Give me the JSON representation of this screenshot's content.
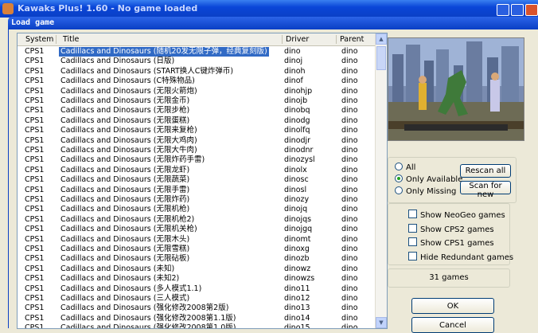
{
  "window": {
    "title": "Kawaks Plus! 1.60 - No game loaded"
  },
  "dialog": {
    "title": "Load game"
  },
  "list": {
    "headers": {
      "system": "System",
      "title": "Title",
      "driver": "Driver",
      "parent": "Parent"
    },
    "rows": [
      {
        "system": "CPS1",
        "title": "Cadillacs and Dinosaurs (随机20发无限子弹，经典复刻版)",
        "driver": "dino",
        "parent": "dino"
      },
      {
        "system": "CPS1",
        "title": "Cadillacs and Dinosaurs (日版)",
        "driver": "dinoj",
        "parent": "dino"
      },
      {
        "system": "CPS1",
        "title": "Cadillacs and Dinosaurs (START换人C键炸弹币)",
        "driver": "dinoh",
        "parent": "dino"
      },
      {
        "system": "CPS1",
        "title": "Cadillacs and Dinosaurs (C特殊物品)",
        "driver": "dinof",
        "parent": "dino"
      },
      {
        "system": "CPS1",
        "title": "Cadillacs and Dinosaurs (无限火箭炮)",
        "driver": "dinohjp",
        "parent": "dino"
      },
      {
        "system": "CPS1",
        "title": "Cadillacs and Dinosaurs (无限金币)",
        "driver": "dinojb",
        "parent": "dino"
      },
      {
        "system": "CPS1",
        "title": "Cadillacs and Dinosaurs (无限步枪)",
        "driver": "dinobq",
        "parent": "dino"
      },
      {
        "system": "CPS1",
        "title": "Cadillacs and Dinosaurs (无限蛋糕)",
        "driver": "dinodg",
        "parent": "dino"
      },
      {
        "system": "CPS1",
        "title": "Cadillacs and Dinosaurs (无限来复枪)",
        "driver": "dinolfq",
        "parent": "dino"
      },
      {
        "system": "CPS1",
        "title": "Cadillacs and Dinosaurs (无限大鸡肉)",
        "driver": "dinodjr",
        "parent": "dino"
      },
      {
        "system": "CPS1",
        "title": "Cadillacs and Dinosaurs (无限大牛肉)",
        "driver": "dinodnr",
        "parent": "dino"
      },
      {
        "system": "CPS1",
        "title": "Cadillacs and Dinosaurs (无限炸药手雷)",
        "driver": "dinozysl",
        "parent": "dino"
      },
      {
        "system": "CPS1",
        "title": "Cadillacs and Dinosaurs (无限龙虾)",
        "driver": "dinolx",
        "parent": "dino"
      },
      {
        "system": "CPS1",
        "title": "Cadillacs and Dinosaurs (无限蔬菜)",
        "driver": "dinosc",
        "parent": "dino"
      },
      {
        "system": "CPS1",
        "title": "Cadillacs and Dinosaurs (无限手雷)",
        "driver": "dinosl",
        "parent": "dino"
      },
      {
        "system": "CPS1",
        "title": "Cadillacs and Dinosaurs (无限炸药)",
        "driver": "dinozy",
        "parent": "dino"
      },
      {
        "system": "CPS1",
        "title": "Cadillacs and Dinosaurs (无限机枪)",
        "driver": "dinojq",
        "parent": "dino"
      },
      {
        "system": "CPS1",
        "title": "Cadillacs and Dinosaurs (无限机枪2)",
        "driver": "dinojqs",
        "parent": "dino"
      },
      {
        "system": "CPS1",
        "title": "Cadillacs and Dinosaurs (无限机关枪)",
        "driver": "dinojgq",
        "parent": "dino"
      },
      {
        "system": "CPS1",
        "title": "Cadillacs and Dinosaurs (无限木头)",
        "driver": "dinomt",
        "parent": "dino"
      },
      {
        "system": "CPS1",
        "title": "Cadillacs and Dinosaurs (无限雪糕)",
        "driver": "dinoxg",
        "parent": "dino"
      },
      {
        "system": "CPS1",
        "title": "Cadillacs and Dinosaurs (无限砧板)",
        "driver": "dinozb",
        "parent": "dino"
      },
      {
        "system": "CPS1",
        "title": "Cadillacs and Dinosaurs (未知)",
        "driver": "dinowz",
        "parent": "dino"
      },
      {
        "system": "CPS1",
        "title": "Cadillacs and Dinosaurs (未知2)",
        "driver": "dinowzs",
        "parent": "dino"
      },
      {
        "system": "CPS1",
        "title": "Cadillacs and Dinosaurs (多人模式1.1)",
        "driver": "dino11",
        "parent": "dino"
      },
      {
        "system": "CPS1",
        "title": "Cadillacs and Dinosaurs (三人模式)",
        "driver": "dino12",
        "parent": "dino"
      },
      {
        "system": "CPS1",
        "title": "Cadillacs and Dinosaurs (强化修改2008第2版)",
        "driver": "dino13",
        "parent": "dino"
      },
      {
        "system": "CPS1",
        "title": "Cadillacs and Dinosaurs (强化修改2008第1.1版)",
        "driver": "dino14",
        "parent": "dino"
      },
      {
        "system": "CPS1",
        "title": "Cadillacs and Dinosaurs (强化修改2008第1.0版)",
        "driver": "dino15",
        "parent": "dino"
      }
    ]
  },
  "filters": {
    "radios": [
      {
        "label": "All",
        "selected": false
      },
      {
        "label": "Only Available",
        "selected": true
      },
      {
        "label": "Only Missing",
        "selected": false
      }
    ],
    "rescan_label": "Rescan all",
    "scan_new_label": "Scan for new"
  },
  "options": [
    {
      "label": "Show NeoGeo games",
      "checked": true
    },
    {
      "label": "Show CPS2 games",
      "checked": true
    },
    {
      "label": "Show CPS1 games",
      "checked": true
    },
    {
      "label": "Hide Redundant games",
      "checked": true
    }
  ],
  "status": {
    "count": "31 games"
  },
  "buttons": {
    "ok": "OK",
    "cancel": "Cancel"
  },
  "icons": {
    "app": "kawaks-app-icon",
    "preview": "game-preview-image"
  },
  "colors": {
    "title_bar": "#0a46d8",
    "selection": "#316ac5",
    "dialog_bg": "#ece9d8"
  }
}
